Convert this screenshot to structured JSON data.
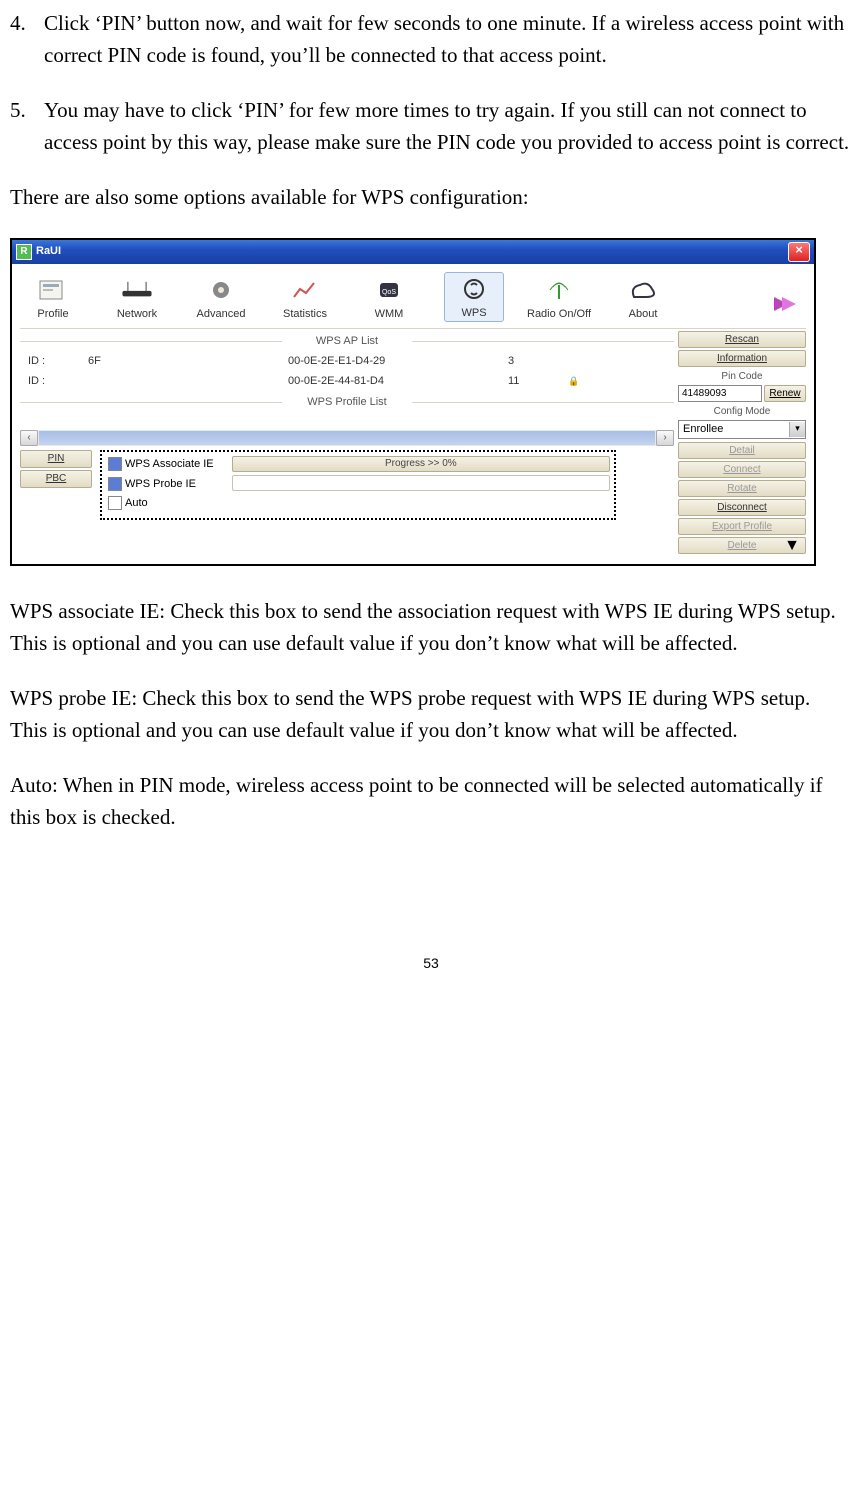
{
  "list": {
    "item4_num": "4.",
    "item4_text": "Click ‘PIN’ button now, and wait for few seconds to one minute. If a wireless access point with correct PIN code is found, you’ll be connected to that access point.",
    "item5_num": "5.",
    "item5_text": "You may have to click ‘PIN’ for few more times to try again. If you still can not connect to access point by this way, please make sure the PIN code you provided to access point is correct."
  },
  "intro_para": "There are also some options available for WPS configuration:",
  "raui": {
    "title": "RaUI",
    "toolbar": {
      "profile": "Profile",
      "network": "Network",
      "advanced": "Advanced",
      "statistics": "Statistics",
      "wmm": "WMM",
      "wps": "WPS",
      "radio": "Radio On/Off",
      "about": "About"
    },
    "sections": {
      "ap_list": "WPS AP List",
      "profile_list": "WPS Profile List"
    },
    "ap_rows": [
      {
        "id": "ID :",
        "ssid": "6F",
        "bssid": "00-0E-2E-E1-D4-29",
        "ch": "3",
        "sec": false
      },
      {
        "id": "ID :",
        "ssid": "",
        "bssid": "00-0E-2E-44-81-D4",
        "ch": "11",
        "sec": true
      }
    ],
    "left_buttons": {
      "pin": "PIN",
      "pbc": "PBC"
    },
    "checkboxes": {
      "assoc": "WPS Associate IE",
      "probe": "WPS Probe IE",
      "auto": "Auto"
    },
    "progress": "Progress >> 0%",
    "side": {
      "rescan": "Rescan",
      "information": "Information",
      "pin_code_label": "Pin Code",
      "pin_value": "41489093",
      "renew": "Renew",
      "config_mode_label": "Config Mode",
      "config_mode_value": "Enrollee",
      "detail": "Detail",
      "connect": "Connect",
      "rotate": "Rotate",
      "disconnect": "Disconnect",
      "export": "Export Profile",
      "delete": "Delete"
    }
  },
  "desc": {
    "assoc": "WPS associate IE: Check this box to send the association request with WPS IE during WPS setup. This is optional and you can use default value if you don’t know what will be affected.",
    "probe": "WPS probe IE: Check this box to send the WPS probe request with WPS IE during WPS setup. This is optional and you can use default value if you don’t know what will be affected.",
    "auto": "Auto: When in PIN mode, wireless access point to be connected will be selected automatically if this box is checked."
  },
  "page_number": "53"
}
